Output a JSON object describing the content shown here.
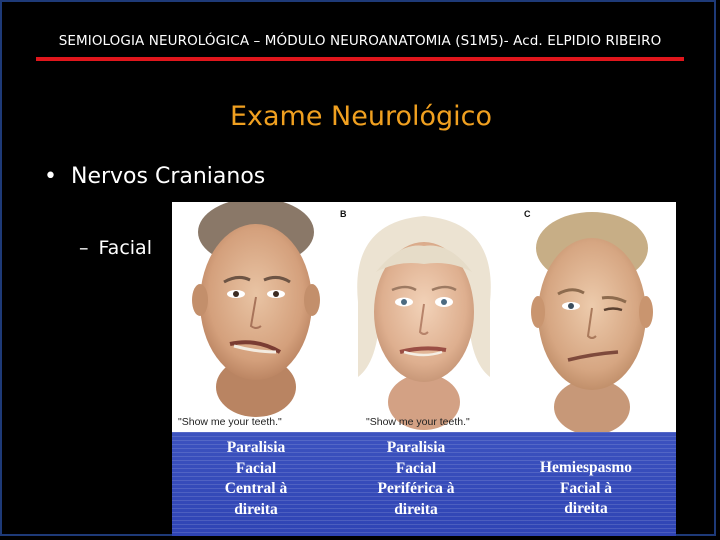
{
  "header": {
    "text": "SEMIOLOGIA NEUROLÓGICA – MÓDULO NEUROANATOMIA (S1M5)- Acd. ELPIDIO RIBEIRO",
    "rule_color": "#e0161c"
  },
  "title": "Exame Neurológico",
  "bullets": {
    "level1": "Nervos Cranianos",
    "level2": "Facial"
  },
  "figure": {
    "panels": [
      {
        "letter": "",
        "quote": "\"Show me your teeth.\"",
        "caption": "Paralisia\nFacial\nCentral à\ndireita"
      },
      {
        "letter": "B",
        "quote": "\"Show me your teeth.\"",
        "caption": "Paralisia\nFacial\nPeriférica à\ndireita"
      },
      {
        "letter": "C",
        "quote": "",
        "caption": "Hemiespasmo\nFacial à\ndireita"
      }
    ],
    "caption_band_color": "#3347b8"
  },
  "colors": {
    "background": "#000000",
    "title": "#f0a020",
    "text": "#ffffff"
  }
}
